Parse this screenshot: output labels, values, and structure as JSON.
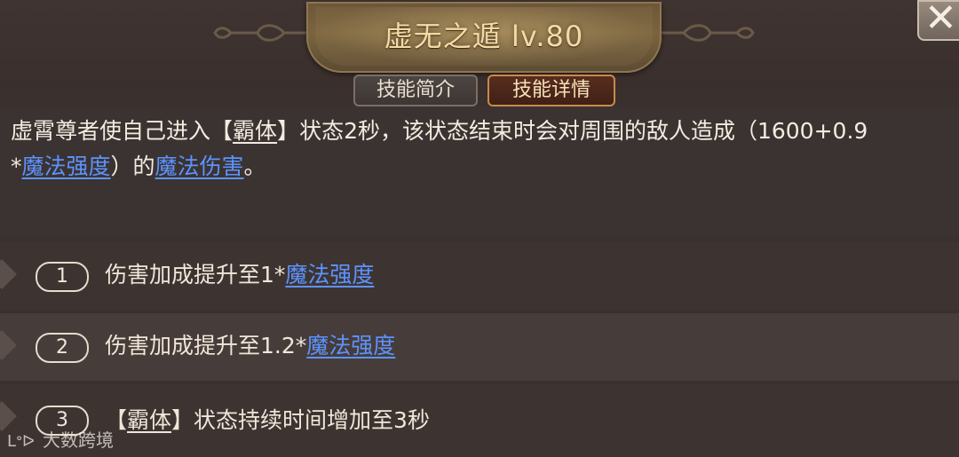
{
  "header": {
    "skill_name": "虚无之遁",
    "level": "lv.80",
    "close_icon": "close-icon"
  },
  "tabs": [
    {
      "label": "技能简介",
      "active": false
    },
    {
      "label": "技能详情",
      "active": true
    }
  ],
  "description": {
    "part1": "虚霄尊者使自己进入",
    "bracket_open": "【",
    "keyword": "霸体",
    "bracket_close": "】",
    "part2": "状态2秒，该状态结束时会对周围的敌人造成（1600+0.9",
    "line2_prefix": "*",
    "blue1": "魔法强度",
    "line2_mid": "）的",
    "blue2": "魔法伤害",
    "line2_end": "。"
  },
  "upgrades": [
    {
      "number": "1",
      "text": "伤害加成提升至1*",
      "blue": "魔法强度"
    },
    {
      "number": "2",
      "text": "伤害加成提升至1.2*",
      "blue": "魔法强度"
    },
    {
      "number": "3",
      "bracket_open": "【",
      "keyword": "霸体",
      "bracket_close": "】",
      "text": "状态持续时间增加至3秒"
    }
  ],
  "watermark": {
    "logo": "ᒪᐤᐅ",
    "text": "大数跨境"
  },
  "colors": {
    "title_gold": "#f6d9a3",
    "link_blue": "#5c93ff",
    "active_tab_border": "#c78a4a",
    "background": "#3a302d"
  }
}
